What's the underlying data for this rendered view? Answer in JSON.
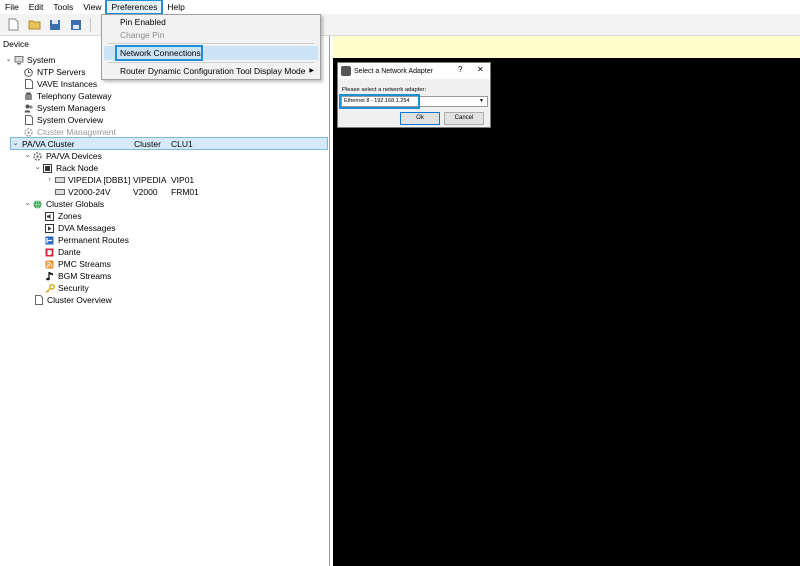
{
  "menubar": {
    "items": [
      "File",
      "Edit",
      "Tools",
      "View",
      "Preferences",
      "Help"
    ]
  },
  "toolbar": {
    "icons": [
      "new-file-icon",
      "open-folder-icon",
      "save-icon",
      "save-all-icon",
      "connect-icon"
    ]
  },
  "preferences_menu": {
    "items": [
      {
        "label": "Pin Enabled",
        "enabled": true
      },
      {
        "label": "Change Pin",
        "enabled": false
      },
      {
        "label": "Network Connections",
        "enabled": true,
        "highlighted": true
      },
      {
        "label": "Router Dynamic Configuration Tool Display Mode",
        "enabled": true,
        "submenu": true
      }
    ]
  },
  "tree": {
    "header": "Device",
    "system": "System",
    "ntp_servers": "NTP Servers",
    "vave_instances": "VAVE Instances",
    "telephony_gateway": "Telephony Gateway",
    "system_managers": "System Managers",
    "system_overview": "System Overview",
    "cluster_management": "Cluster Management",
    "pava_cluster": {
      "name": "PA/VA Cluster",
      "type": "Cluster",
      "id": "CLU1"
    },
    "pava_devices": "PA/VA Devices",
    "rack_node": "Rack Node",
    "vipedia": {
      "name": "VIPEDIA [DBB1]",
      "type": "VIPEDIA",
      "id": "VIP01"
    },
    "v2000": {
      "name": "V2000-24V",
      "type": "V2000",
      "id": "FRM01"
    },
    "cluster_globals": "Cluster Globals",
    "zones": "Zones",
    "dva_messages": "DVA Messages",
    "permanent_routes": "Permanent Routes",
    "dante": "Dante",
    "pmc_streams": "PMC Streams",
    "bgm_streams": "BGM Streams",
    "security": "Security",
    "cluster_overview": "Cluster Overview"
  },
  "dialog": {
    "title": "Select a Network Adapter",
    "help": "?",
    "close": "✕",
    "prompt": "Please select a network adapter:",
    "selected_adapter": "Ethernet 8 - 192.168.1.254",
    "ok_label": "Ok",
    "cancel_label": "Cancel"
  },
  "colors": {
    "highlight": "#1e90d6",
    "right_strip": "#ffffcc",
    "right_area": "#000000"
  }
}
